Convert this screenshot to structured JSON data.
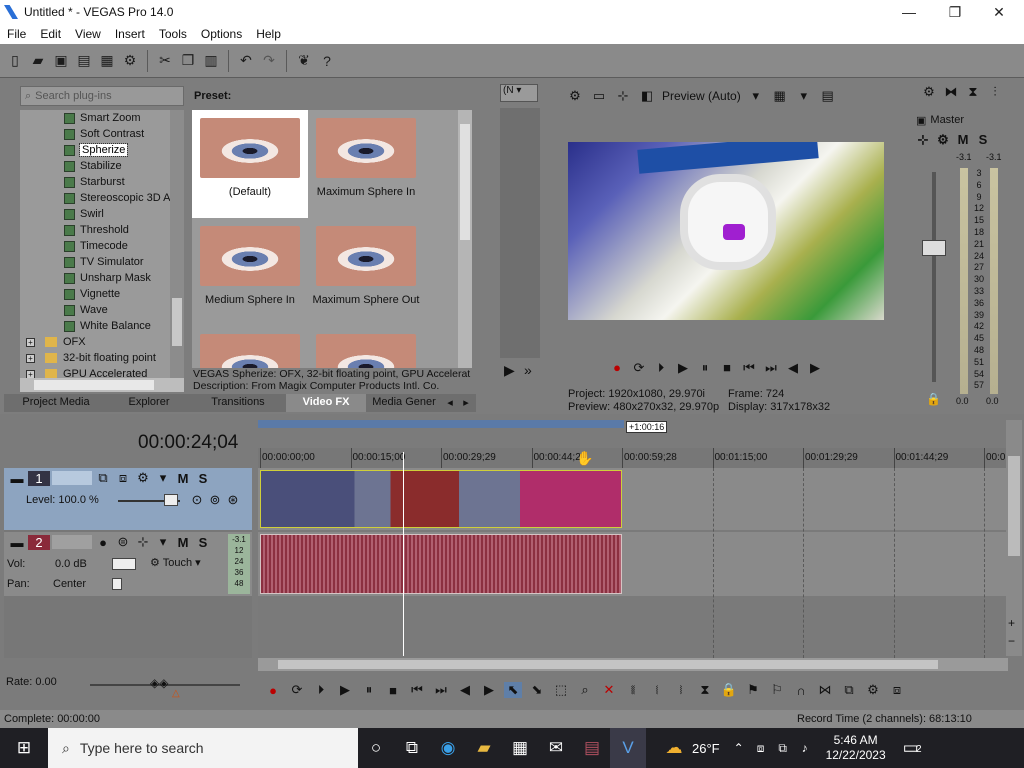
{
  "window": {
    "title": "Untitled * - VEGAS Pro 14.0",
    "minimize": "—",
    "maximize": "❐",
    "close": "✕"
  },
  "menu": [
    "File",
    "Edit",
    "View",
    "Insert",
    "Tools",
    "Options",
    "Help"
  ],
  "plugins": {
    "search_placeholder": "Search plug-ins",
    "preset_label": "Preset:",
    "tree": [
      {
        "label": "Smart Zoom",
        "kind": "fx"
      },
      {
        "label": "Soft Contrast",
        "kind": "fx"
      },
      {
        "label": "Spherize",
        "kind": "fx",
        "selected": true
      },
      {
        "label": "Stabilize",
        "kind": "fx"
      },
      {
        "label": "Starburst",
        "kind": "fx"
      },
      {
        "label": "Stereoscopic 3D A",
        "kind": "fx"
      },
      {
        "label": "Swirl",
        "kind": "fx"
      },
      {
        "label": "Threshold",
        "kind": "fx"
      },
      {
        "label": "Timecode",
        "kind": "fx"
      },
      {
        "label": "TV Simulator",
        "kind": "fx"
      },
      {
        "label": "Unsharp Mask",
        "kind": "fx"
      },
      {
        "label": "Vignette",
        "kind": "fx"
      },
      {
        "label": "Wave",
        "kind": "fx"
      },
      {
        "label": "White Balance",
        "kind": "fx"
      },
      {
        "label": "OFX",
        "kind": "folder"
      },
      {
        "label": "32-bit floating point",
        "kind": "folder"
      },
      {
        "label": "GPU Accelerated",
        "kind": "folder"
      }
    ],
    "presets": [
      "(Default)",
      "Maximum Sphere In",
      "Medium Sphere In",
      "Maximum Sphere Out"
    ],
    "description_line1": "VEGAS Spherize: OFX, 32-bit floating point, GPU Accelerat",
    "description_line2": "Description: From Magix Computer Products Intl. Co.",
    "tabs": [
      "Project Media",
      "Explorer",
      "Transitions",
      "Video FX",
      "Media Gener"
    ],
    "active_tab": "Video FX"
  },
  "trimmer": {
    "dropdown": "(N"
  },
  "preview": {
    "mode": "Preview (Auto)",
    "project_label": "Project:",
    "project_value": "1920x1080, 29.970i",
    "preview_label": "Preview:",
    "preview_value": "480x270x32, 29.970p",
    "frame_label": "Frame:",
    "frame_value": "724",
    "display_label": "Display:",
    "display_value": "317x178x32"
  },
  "master": {
    "label": "Master",
    "m": "M",
    "s": "S",
    "left_peak": "-3.1",
    "right_peak": "-3.1",
    "scale": [
      "3",
      "6",
      "9",
      "12",
      "15",
      "18",
      "21",
      "24",
      "27",
      "30",
      "33",
      "36",
      "39",
      "42",
      "45",
      "48",
      "51",
      "54",
      "57"
    ],
    "left_val": "0.0",
    "right_val": "0.0"
  },
  "timeline": {
    "time": "00:00:24;04",
    "region": "+1:00:16",
    "ruler": [
      "00:00:00;00",
      "00:00:15;00",
      "00:00:29;29",
      "00:00:44;29",
      "00:00:59;28",
      "00:01:15;00",
      "00:01:29;29",
      "00:01:44;29",
      "00:0"
    ],
    "video_track": {
      "number": "1",
      "level": "Level: 100.0 %",
      "m": "M",
      "s": "S"
    },
    "audio_track": {
      "number": "2",
      "m": "M",
      "s": "S",
      "vol_label": "Vol:",
      "vol_value": "0.0 dB",
      "pan_label": "Pan:",
      "pan_value": "Center",
      "touch": "Touch",
      "peak": "-3.1",
      "meter": [
        "12",
        "24",
        "36",
        "48"
      ]
    },
    "rate": "Rate: 0.00"
  },
  "status": {
    "complete": "Complete: 00:00:00",
    "record_time": "Record Time (2 channels): 68:13:10"
  },
  "taskbar": {
    "search": "Type here to search",
    "weather": "26°F",
    "time": "5:46 AM",
    "date": "12/22/2023",
    "notifications": "2"
  }
}
